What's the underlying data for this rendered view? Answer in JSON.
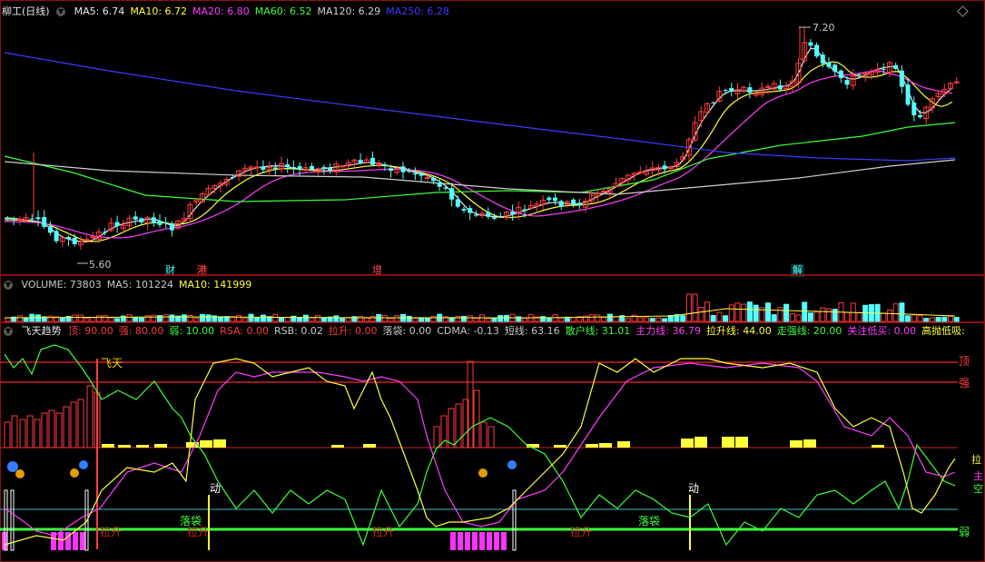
{
  "main_panel": {
    "stock_name": "柳工(日线)",
    "indicators": [
      {
        "label": "MA5: 6.74",
        "color": "#e8e8e8"
      },
      {
        "label": "MA10: 6.72",
        "color": "#ffff3c"
      },
      {
        "label": "MA20: 6.80",
        "color": "#ff3cff"
      },
      {
        "label": "MA60: 6.52",
        "color": "#3cff3c"
      },
      {
        "label": "MA120: 6.29",
        "color": "#d0d0d0"
      },
      {
        "label": "MA250: 6.28",
        "color": "#3c3cff"
      }
    ],
    "high_label": "7.20",
    "low_label": "5.60",
    "events": [
      "财",
      "港",
      "增",
      "解"
    ]
  },
  "volume_panel": {
    "indicators": [
      {
        "label": "VOLUME: 73803",
        "color": "#c8c8c8"
      },
      {
        "label": "MA5: 101224",
        "color": "#c8c8c8"
      },
      {
        "label": "MA10: 141999",
        "color": "#ffff3c"
      }
    ]
  },
  "indicator_panel": {
    "name": "飞天趋势",
    "indicators": [
      {
        "label": "顶: 90.00",
        "color": "#ff3c3c"
      },
      {
        "label": "强: 80.00",
        "color": "#ff3c3c"
      },
      {
        "label": "弱: 10.00",
        "color": "#3cff3c"
      },
      {
        "label": "RSA: 0.00",
        "color": "#ff3c3c"
      },
      {
        "label": "RSB: 0.02",
        "color": "#c8c8c8"
      },
      {
        "label": "拉升: 0.00",
        "color": "#ff3c3c"
      },
      {
        "label": "落袋: 0.00",
        "color": "#c8c8c8"
      },
      {
        "label": "CDMA: -0.13",
        "color": "#c8c8c8"
      },
      {
        "label": "短线: 63.16",
        "color": "#c8c8c8"
      },
      {
        "label": "散户线: 31.01",
        "color": "#3cff3c"
      },
      {
        "label": "主力线: 36.79",
        "color": "#ff3cff"
      },
      {
        "label": "拉升线: 44.00",
        "color": "#ffff3c"
      },
      {
        "label": "走强线: 20.00",
        "color": "#3cff3c"
      },
      {
        "label": "关注低买: 0.00",
        "color": "#ff3cff"
      },
      {
        "label": "高抛低吸: 0.00",
        "color": "#ffff3c"
      }
    ],
    "chart_labels": {
      "feitian": "飞天",
      "top": "顶",
      "strong": "强",
      "weak": "弱",
      "la": "拉",
      "zhu": "主",
      "kong": "空",
      "dong1": "动",
      "dong2": "动",
      "luodai1": "落袋",
      "luodai2": "落袋",
      "lasheng1": "拉升",
      "lasheng2": "拉升",
      "lasheng3": "拉升",
      "lasheng4": "拉升"
    }
  },
  "colors": {
    "frame": "#8c1010",
    "up": "#ff3c3c",
    "down": "#54ffff",
    "ma5": "#e8e8e8",
    "ma10": "#ffff3c",
    "ma20": "#ff3cff",
    "ma60": "#3cff3c",
    "ma120": "#d0d0d0",
    "ma250": "#3c3cff"
  }
}
